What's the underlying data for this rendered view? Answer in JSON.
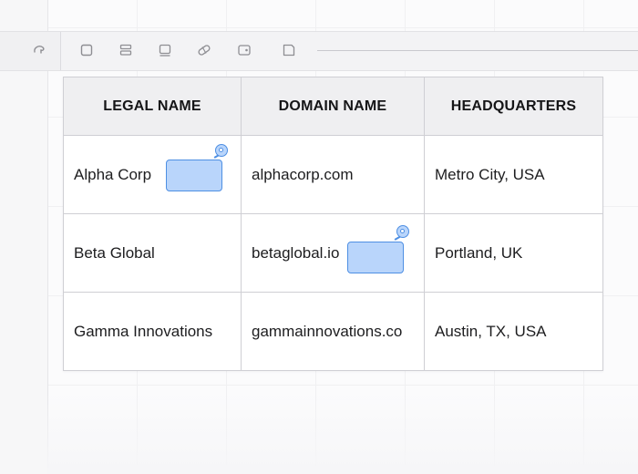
{
  "toolbar": {
    "tools": [
      {
        "icon": "lasso-icon"
      },
      {
        "icon": "square-icon"
      },
      {
        "icon": "stack-icon"
      },
      {
        "icon": "inbox-icon"
      },
      {
        "icon": "pill-icon"
      },
      {
        "icon": "tag-icon"
      },
      {
        "icon": "frame-icon"
      }
    ]
  },
  "table": {
    "headers": [
      "LEGAL NAME",
      "DOMAIN NAME",
      "HEADQUARTERS"
    ],
    "rows": [
      [
        "Alpha Corp",
        "alphacorp.com",
        "Metro City, USA"
      ],
      [
        "Beta Global",
        "betaglobal.io",
        "Portland, UK"
      ],
      [
        "Gamma Innovations",
        "gammainnovations.co",
        "Austin, TX, USA"
      ]
    ]
  },
  "colors": {
    "chip_fill": "#b9d5fb",
    "chip_border": "#4e8fe3",
    "header_bg": "#efeff1",
    "grid_line": "#cfcfd4"
  }
}
